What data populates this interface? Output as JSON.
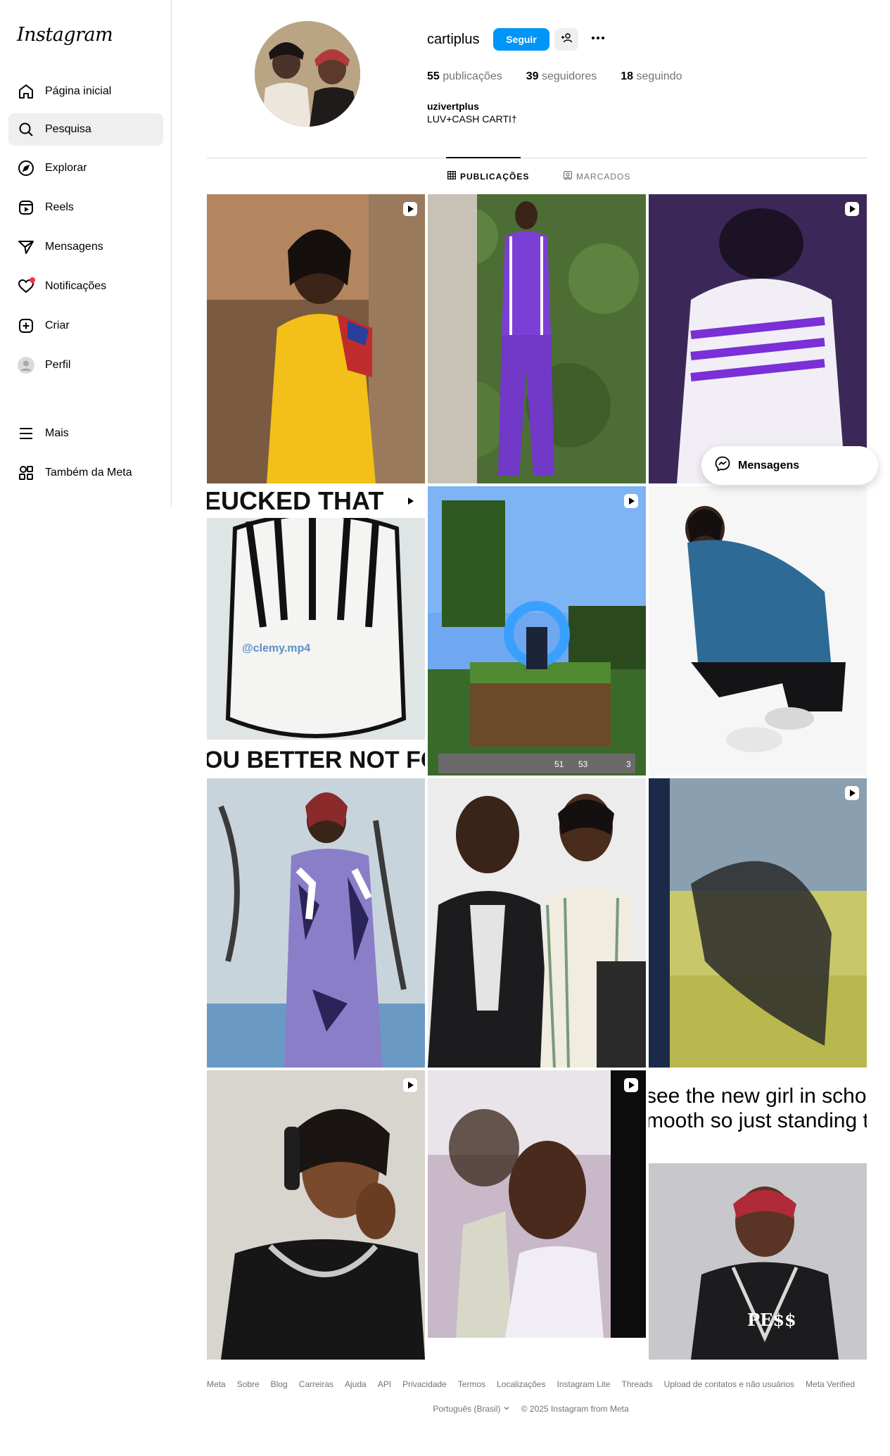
{
  "app": {
    "logo": "Instagram"
  },
  "sidebar": {
    "items": [
      {
        "label": "Página inicial",
        "icon": "home-icon"
      },
      {
        "label": "Pesquisa",
        "icon": "search-icon"
      },
      {
        "label": "Explorar",
        "icon": "compass-icon"
      },
      {
        "label": "Reels",
        "icon": "reels-icon"
      },
      {
        "label": "Mensagens",
        "icon": "send-icon"
      },
      {
        "label": "Notificações",
        "icon": "heart-icon"
      },
      {
        "label": "Criar",
        "icon": "plus-square-icon"
      },
      {
        "label": "Perfil",
        "icon": "avatar-icon"
      },
      {
        "label": "Mais",
        "icon": "menu-icon"
      },
      {
        "label": "Também da Meta",
        "icon": "meta-apps-icon"
      }
    ],
    "active": "Pesquisa",
    "notification_dot_color": "#ff3040"
  },
  "profile": {
    "username": "cartiplus",
    "follow_label": "Seguir",
    "posts_count": "55",
    "posts_label": "publicações",
    "followers_count": "39",
    "followers_label": "seguidores",
    "following_count": "18",
    "following_label": "seguindo",
    "full_name": "uzivertplus",
    "bio": "LUV+CASH CARTI†"
  },
  "tabs": [
    {
      "label": "PUBLICAÇÕES",
      "icon": "grid-icon",
      "active": true
    },
    {
      "label": "MARCADOS",
      "icon": "tagged-icon",
      "active": false
    }
  ],
  "posts": [
    {
      "reel": true
    },
    {
      "reel": false
    },
    {
      "reel": true
    },
    {
      "reel": true,
      "text": [
        "EUCKED THAT",
        "@clemy.mp4",
        "OU BETTER NOT FORG"
      ]
    },
    {
      "reel": true,
      "text": [
        "51",
        "53",
        "3"
      ]
    },
    {
      "reel": false
    },
    {
      "reel": false
    },
    {
      "reel": false
    },
    {
      "reel": true
    },
    {
      "reel": true
    },
    {
      "reel": true
    },
    {
      "reel": false,
      "text": [
        "see the new girl in school",
        "mooth so just standing th",
        "PE$$"
      ]
    }
  ],
  "messages_float": {
    "label": "Mensagens"
  },
  "footer": {
    "links": [
      "Meta",
      "Sobre",
      "Blog",
      "Carreiras",
      "Ajuda",
      "API",
      "Privacidade",
      "Termos",
      "Localizações",
      "Instagram Lite",
      "Threads",
      "Upload de contatos e não usuários",
      "Meta Verified"
    ],
    "language": "Português (Brasil)",
    "copyright": "© 2025 Instagram from Meta"
  },
  "colors": {
    "accent": "#0095f6",
    "text_secondary": "#737373",
    "border": "#dbdbdb"
  }
}
